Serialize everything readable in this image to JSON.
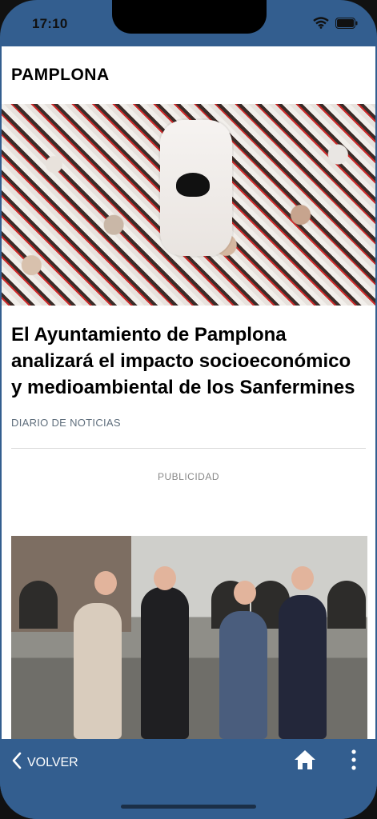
{
  "status_bar": {
    "time": "17:10"
  },
  "section": {
    "title": "PAMPLONA"
  },
  "article": {
    "headline": "El Ayuntamiento de Pamplona analizará el impacto socioeconómico y medioambiental de los Sanfermines",
    "source": "DIARIO DE NOTICIAS"
  },
  "ad": {
    "label": "PUBLICIDAD"
  },
  "bottom_bar": {
    "back_label": "VOLVER"
  },
  "icons": [
    "wifi-icon",
    "battery-icon",
    "chevron-left-icon",
    "home-icon",
    "more-vertical-icon"
  ],
  "colors": {
    "accent": "#335e8f",
    "source_text": "#5f6e7c"
  }
}
